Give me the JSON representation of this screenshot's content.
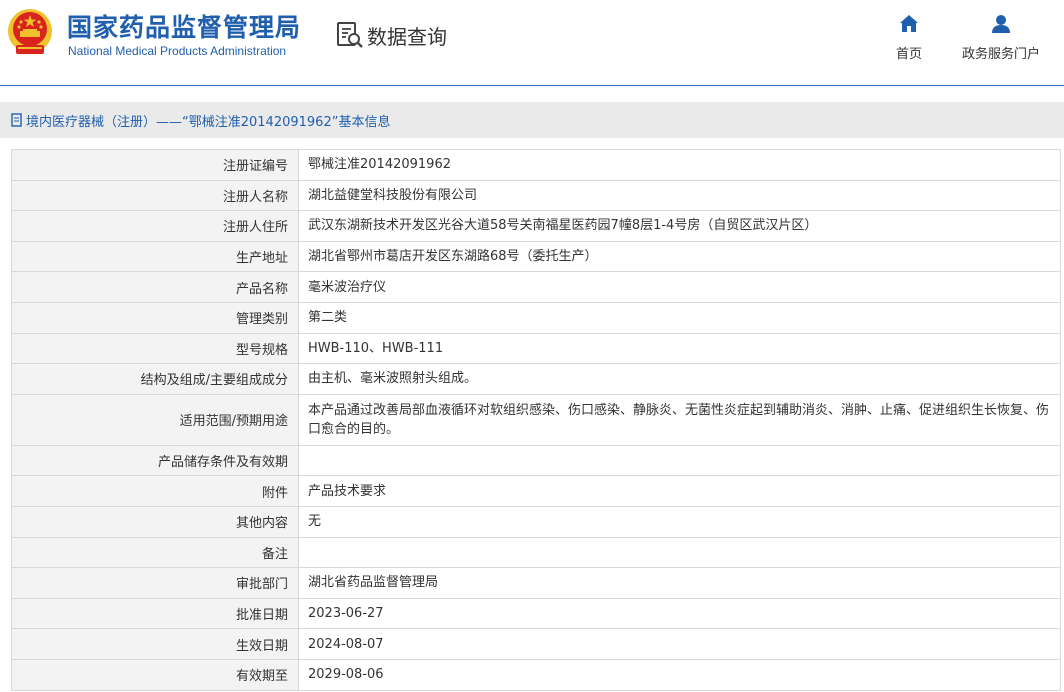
{
  "header": {
    "brand_cn": "国家药品监督管理局",
    "brand_en": "National Medical Products Administration",
    "query_label": "数据查询",
    "nav": [
      {
        "label": "首页",
        "icon": "home-icon"
      },
      {
        "label": "政务服务门户",
        "icon": "user-icon"
      }
    ],
    "colors": {
      "brand": "#1f5fae",
      "emblem_red": "#d8241c",
      "emblem_gold": "#f2c12e"
    }
  },
  "title_bar": {
    "text": "境内医疗器械（注册）——“鄂械注准20142091962”基本信息",
    "icon": "document-icon"
  },
  "details": [
    {
      "label": "注册证编号",
      "value": "鄂械注准20142091962"
    },
    {
      "label": "注册人名称",
      "value": "湖北益健堂科技股份有限公司"
    },
    {
      "label": "注册人住所",
      "value": "武汉东湖新技术开发区光谷大道58号关南福星医药园7幢8层1-4号房（自贸区武汉片区）"
    },
    {
      "label": "生产地址",
      "value": "湖北省鄂州市葛店开发区东湖路68号（委托生产）"
    },
    {
      "label": "产品名称",
      "value": "毫米波治疗仪"
    },
    {
      "label": "管理类别",
      "value": "第二类"
    },
    {
      "label": "型号规格",
      "value": "HWB-110、HWB-111"
    },
    {
      "label": "结构及组成/主要组成成分",
      "value": "由主机、毫米波照射头组成。"
    },
    {
      "label": "适用范围/预期用途",
      "value": "本产品通过改善局部血液循环对软组织感染、伤口感染、静脉炎、无菌性炎症起到辅助消炎、消肿、止痛、促进组织生长恢复、伤口愈合的目的。"
    },
    {
      "label": "产品储存条件及有效期",
      "value": ""
    },
    {
      "label": "附件",
      "value": "产品技术要求"
    },
    {
      "label": "其他内容",
      "value": "无"
    },
    {
      "label": "备注",
      "value": ""
    },
    {
      "label": "审批部门",
      "value": "湖北省药品监督管理局"
    },
    {
      "label": "批准日期",
      "value": "2023-06-27"
    },
    {
      "label": "生效日期",
      "value": "2024-08-07"
    },
    {
      "label": "有效期至",
      "value": "2029-08-06"
    }
  ]
}
